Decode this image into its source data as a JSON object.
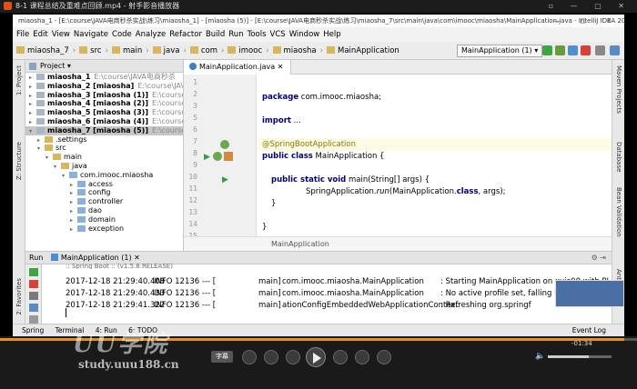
{
  "player": {
    "title": "8-1 课程总结及重难点回顾.mp4 - 射手影音播放器",
    "subtitle_button": "字幕",
    "time": "-01:34",
    "progress_fraction": 0.98,
    "volume_fraction": 0.64,
    "watermark": "UU学院",
    "watermark_url": "study.uuu188.cn"
  },
  "ide": {
    "window_title": "miaosha_1 - [E:\\course\\JAVA电商秒杀实战\\练习\\miaosha_1] - [miaosha (5)] - [E:\\course\\JAVA电商秒杀实战\\练习\\miaosha_7\\src\\main\\java\\com\\imooc\\miaosha\\MainApplication.java - IntelliJ IDEA 2017.2.4",
    "menu": [
      "File",
      "Edit",
      "View",
      "Navigate",
      "Code",
      "Analyze",
      "Refactor",
      "Build",
      "Run",
      "Tools",
      "VCS",
      "Window",
      "Help"
    ],
    "breadcrumbs": [
      "miaosha_7",
      "src",
      "main",
      "java",
      "com",
      "imooc",
      "miaosha",
      "MainApplication"
    ],
    "run_config": "MainApplication (1)",
    "left_strip": [
      "1: Project",
      "Z: Structure",
      "2: Favorites"
    ],
    "right_strip": [
      "Maven Projects",
      "Database",
      "Bean Validation",
      "Ant Build"
    ]
  },
  "project": {
    "header": "Project",
    "rows": [
      {
        "name": "miaosha_1",
        "extra": "E:\\course\\JAVA电商秒杀",
        "indent": 0,
        "bold": true
      },
      {
        "name": "miaosha_2 [miaosha]",
        "extra": "E:\\course\\JAVA",
        "indent": 0,
        "bold": true
      },
      {
        "name": "miaosha_3 [miaosha (1)]",
        "extra": "E:\\course\\",
        "indent": 0,
        "bold": true
      },
      {
        "name": "miaosha_4 [miaosha (2)]",
        "extra": "E:\\course\\",
        "indent": 0,
        "bold": true
      },
      {
        "name": "miaosha_5 [miaosha (3)]",
        "extra": "E:\\course\\",
        "indent": 0,
        "bold": true
      },
      {
        "name": "miaosha_6 [miaosha (4)]",
        "extra": "E:\\course\\",
        "indent": 0,
        "bold": true
      },
      {
        "name": "miaosha_7 [miaosha (5)]",
        "extra": "E:\\course\\",
        "indent": 0,
        "bold": true,
        "selected": true
      },
      {
        "name": ".settings",
        "extra": "",
        "indent": 1,
        "bold": false
      },
      {
        "name": "src",
        "extra": "",
        "indent": 1,
        "bold": false
      },
      {
        "name": "main",
        "extra": "",
        "indent": 2,
        "bold": false
      },
      {
        "name": "java",
        "extra": "",
        "indent": 3,
        "bold": false
      },
      {
        "name": "com.imooc.miaosha",
        "extra": "",
        "indent": 4,
        "bold": false
      },
      {
        "name": "access",
        "extra": "",
        "indent": 5,
        "bold": false
      },
      {
        "name": "config",
        "extra": "",
        "indent": 5,
        "bold": false
      },
      {
        "name": "controller",
        "extra": "",
        "indent": 5,
        "bold": false
      },
      {
        "name": "dao",
        "extra": "",
        "indent": 5,
        "bold": false
      },
      {
        "name": "domain",
        "extra": "",
        "indent": 5,
        "bold": false
      },
      {
        "name": "exception",
        "extra": "",
        "indent": 5,
        "bold": false
      }
    ]
  },
  "editor": {
    "tab": "MainApplication.java",
    "line_numbers": [
      "1",
      "2",
      "3",
      "5",
      "6",
      "7",
      "8",
      "9",
      "10",
      "11",
      "12",
      "13",
      "14",
      "15"
    ],
    "footer": "MainApplication",
    "code": {
      "l1_kw": "package",
      "l1_rest": " com.imooc.miaosha;",
      "l3_kw": "import",
      "l3_rest": " ...",
      "l7_ann": "@SpringBootApplication",
      "l8_kw": "public class",
      "l8_rest": " MainApplication {",
      "l10_kw": "public static void",
      "l10_rest": " main(String[] args) {",
      "l11_pre": "SpringApplication.",
      "l11_it": "run",
      "l11_mid": "(MainApplication.",
      "l11_kw": "class",
      "l11_end": ", args);",
      "l12": "}",
      "l14": "}"
    }
  },
  "run": {
    "label": "Run",
    "config": "MainApplication (1)",
    "partial_line": ":: Spring Boot ::        (v1.5.8.RELEASE)",
    "lines": [
      {
        "ts": "2017-12-18 21:29:40.408",
        "level": "INFO 12136 --- [",
        "thread": "main]",
        "cls": "com.imooc.miaosha.MainApplication",
        "msg": ": Starting MainApplication on xujs00 with PI"
      },
      {
        "ts": "2017-12-18 21:29:40.433",
        "level": "INFO 12136 --- [",
        "thread": "main]",
        "cls": "com.imooc.miaosha.MainApplication",
        "msg": ": No active profile set, falling back"
      },
      {
        "ts": "2017-12-18 21:29:41.322",
        "level": "INFO 12136 --- [",
        "thread": "main]",
        "cls": "ationConfigEmbeddedWebApplicationContext",
        "msg": ": Refreshing org.springf"
      }
    ]
  },
  "statusbar": {
    "items": [
      "Spring",
      "Terminal",
      "4: Run",
      "6: TODO"
    ],
    "event_log": "Event Log"
  }
}
